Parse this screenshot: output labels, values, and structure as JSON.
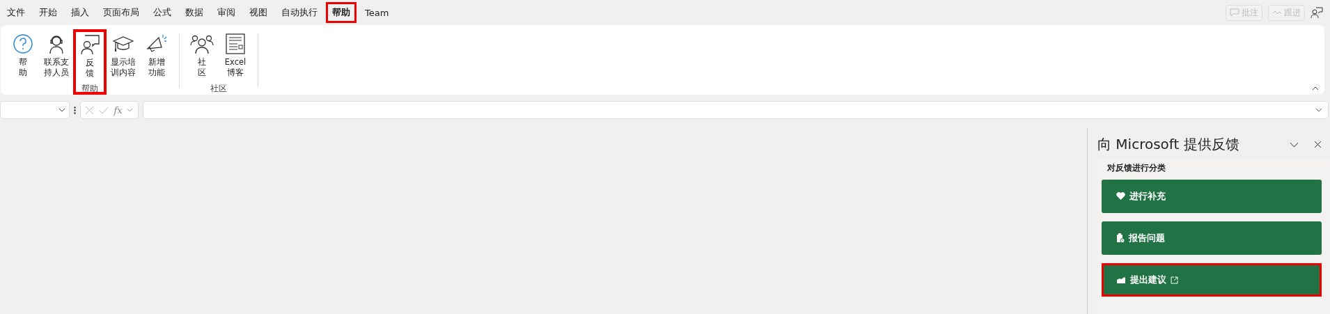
{
  "menu_tabs": [
    {
      "label": "文件",
      "selected": false,
      "highlighted": false
    },
    {
      "label": "开始",
      "selected": false,
      "highlighted": false
    },
    {
      "label": "插入",
      "selected": false,
      "highlighted": false
    },
    {
      "label": "页面布局",
      "selected": false,
      "highlighted": false
    },
    {
      "label": "公式",
      "selected": false,
      "highlighted": false
    },
    {
      "label": "数据",
      "selected": false,
      "highlighted": false
    },
    {
      "label": "审阅",
      "selected": false,
      "highlighted": false
    },
    {
      "label": "视图",
      "selected": false,
      "highlighted": false
    },
    {
      "label": "自动执行",
      "selected": false,
      "highlighted": false
    },
    {
      "label": "帮助",
      "selected": true,
      "highlighted": true
    },
    {
      "label": "Team",
      "selected": false,
      "highlighted": false
    }
  ],
  "top_right": {
    "comments": "批注",
    "follow_up": "跟进"
  },
  "ribbon": {
    "groups": [
      {
        "label": "帮助",
        "items": [
          {
            "kind": "help",
            "lines": [
              "帮",
              "助"
            ],
            "highlighted": false
          },
          {
            "kind": "support",
            "lines": [
              "联系支",
              "持人员"
            ],
            "highlighted": false
          },
          {
            "kind": "feedback",
            "lines": [
              "反",
              "馈"
            ],
            "highlighted": true
          },
          {
            "kind": "training",
            "lines": [
              "显示培",
              "训内容"
            ],
            "highlighted": false
          },
          {
            "kind": "whatsnew",
            "lines": [
              "新增",
              "功能"
            ],
            "highlighted": false
          }
        ]
      },
      {
        "label": "社区",
        "items": [
          {
            "kind": "community",
            "lines": [
              "社",
              "区"
            ],
            "highlighted": false
          },
          {
            "kind": "blog",
            "lines": [
              "Excel",
              "博客"
            ],
            "highlighted": false
          }
        ]
      }
    ]
  },
  "formula_bar": {
    "fx": "fx"
  },
  "pane": {
    "title": "向 Microsoft 提供反馈",
    "section": "对反馈进行分类",
    "buttons": [
      {
        "kind": "heart",
        "label": "进行补充",
        "external": false,
        "highlighted": false
      },
      {
        "kind": "clipboard",
        "label": "报告问题",
        "external": false,
        "highlighted": false
      },
      {
        "kind": "idea",
        "label": "提出建议",
        "external": true,
        "highlighted": true
      }
    ]
  }
}
